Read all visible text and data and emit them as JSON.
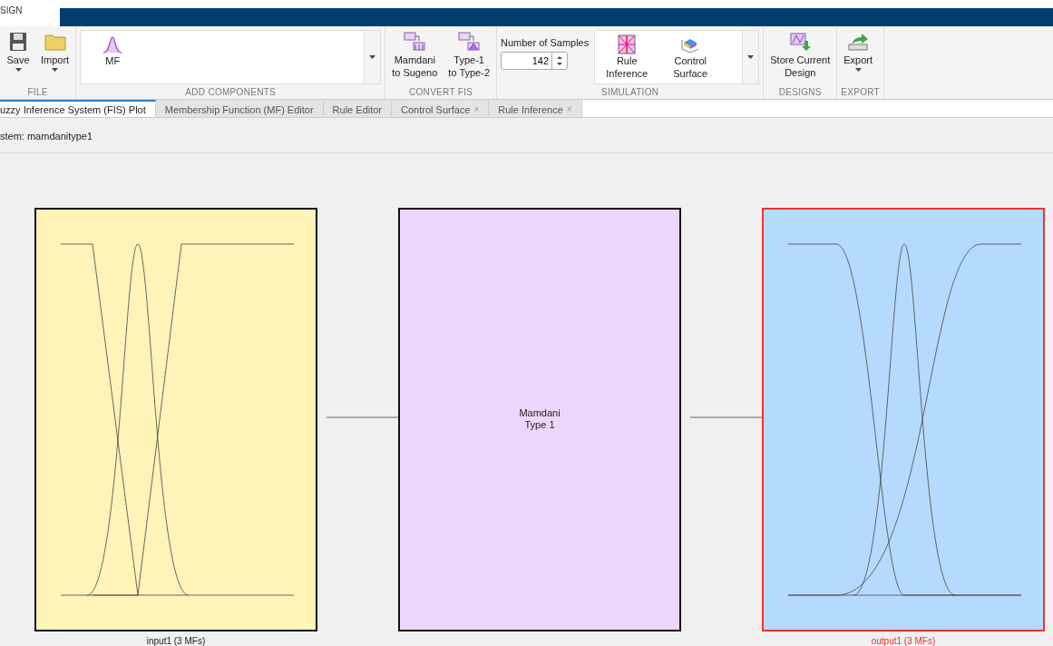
{
  "top_tab": {
    "label": "SIGN"
  },
  "ribbon": [
    {
      "title": "FILE",
      "items": [
        {
          "kind": "button",
          "label": "Save",
          "dropdown": true
        },
        {
          "kind": "button",
          "label": "Import",
          "dropdown": true
        }
      ]
    },
    {
      "title": "ADD COMPONENTS",
      "items": [
        {
          "kind": "gallery",
          "entries": [
            {
              "label": "MF"
            }
          ]
        }
      ]
    },
    {
      "title": "CONVERT FIS",
      "items": [
        {
          "kind": "button",
          "label": "Mamdani\nto Sugeno",
          "dropdown": false
        },
        {
          "kind": "button",
          "label": "Type-1\nto Type-2",
          "dropdown": false
        }
      ]
    },
    {
      "title": "SIMULATION",
      "items": [
        {
          "kind": "spinner",
          "label": "Number of Samples",
          "value": "142"
        },
        {
          "kind": "gallery",
          "entries": [
            {
              "label": "Rule\nInference"
            },
            {
              "label": "Control\nSurface"
            }
          ]
        }
      ]
    },
    {
      "title": "DESIGNS",
      "items": [
        {
          "kind": "button",
          "label": "Store Current\nDesign",
          "dropdown": false
        }
      ]
    },
    {
      "title": "EXPORT",
      "items": [
        {
          "kind": "button",
          "label": "Export",
          "dropdown": true
        }
      ]
    }
  ],
  "tabs": [
    {
      "label": "uzzy Inference System (FIS) Plot",
      "selected": true
    },
    {
      "label": "Membership Function (MF) Editor",
      "selected": false
    },
    {
      "label": "Rule Editor",
      "selected": false
    },
    {
      "label": "Control Surface",
      "selected": false,
      "close": "×"
    },
    {
      "label": "Rule Inference",
      "selected": false,
      "close": "×"
    }
  ],
  "system_label": "stem: mamdanitype1",
  "blocks": [
    {
      "kind": "input",
      "label": "input1 (3 MFs)",
      "selected": false
    },
    {
      "kind": "system",
      "text": "Mamdani\nType 1",
      "selected": false
    },
    {
      "kind": "output",
      "label": "output1 (3 MFs)",
      "selected": true
    }
  ]
}
